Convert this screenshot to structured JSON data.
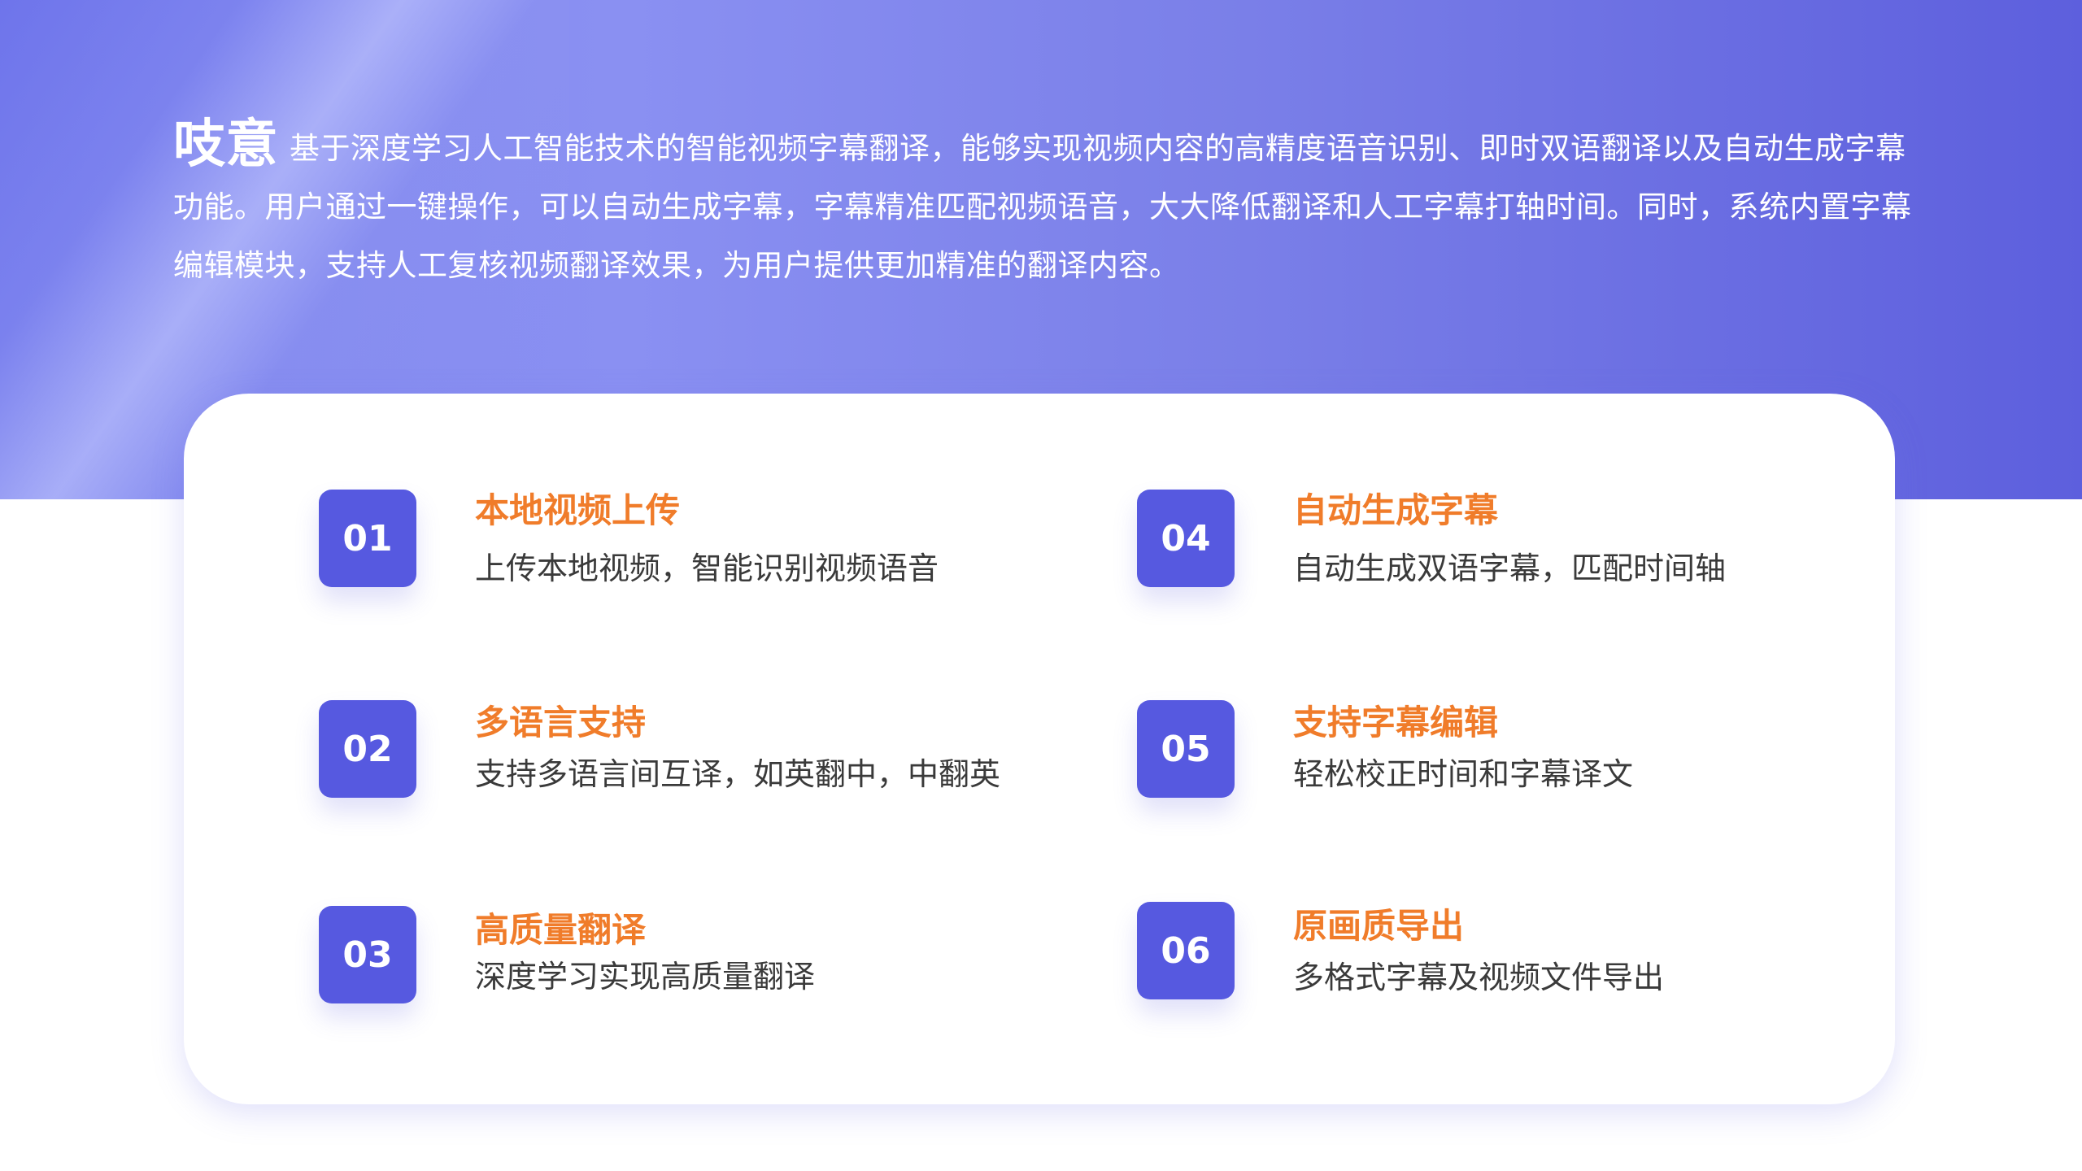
{
  "header": {
    "brand": "吱意",
    "description": "基于深度学习人工智能技术的智能视频字幕翻译，能够实现视频内容的高精度语音识别、即时双语翻译以及自动生成字幕功能。用户通过一键操作，可以自动生成字幕，字幕精准匹配视频语音，大大降低翻译和人工字幕打轴时间。同时，系统内置字幕编辑模块，支持人工复核视频翻译效果，为用户提供更加精准的翻译内容。"
  },
  "features": [
    {
      "number": "01",
      "title": "本地视频上传",
      "description": "上传本地视频，智能识别视频语音"
    },
    {
      "number": "02",
      "title": "多语言支持",
      "description": "支持多语言间互译，如英翻中，中翻英"
    },
    {
      "number": "03",
      "title": "高质量翻译",
      "description": "深度学习实现高质量翻译"
    },
    {
      "number": "04",
      "title": "自动生成字幕",
      "description": "自动生成双语字幕，匹配时间轴"
    },
    {
      "number": "05",
      "title": "支持字幕编辑",
      "description": "轻松校正时间和字幕译文"
    },
    {
      "number": "06",
      "title": "原画质导出",
      "description": "多格式字幕及视频文件导出"
    }
  ],
  "colors": {
    "accent": "#5659e0",
    "title_orange": "#f07c2a",
    "hero_gradient_end": "#5d5fdd"
  }
}
